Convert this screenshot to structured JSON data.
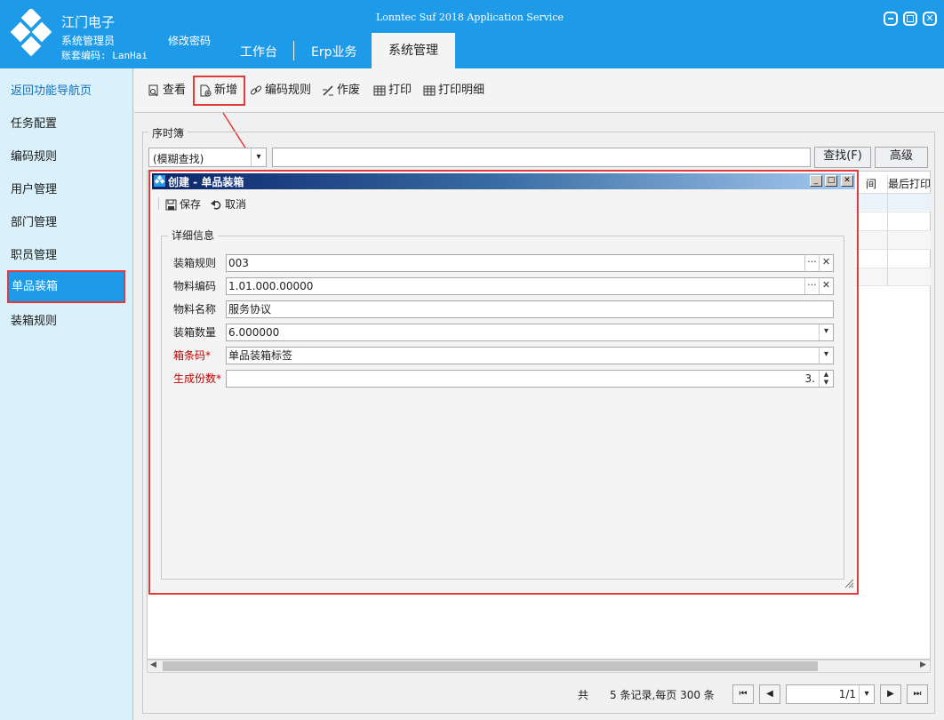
{
  "app": {
    "company": "江门电子",
    "user_role": "系统管理员",
    "account_label": "账套编码: LanHai",
    "window_title": "Lonntec Suf 2018 Application Service"
  },
  "header": {
    "change_password": "修改密码",
    "tabs": [
      {
        "label": "工作台"
      },
      {
        "label": "Erp业务"
      },
      {
        "label": "系统管理",
        "active": true
      }
    ]
  },
  "sidebar": {
    "items": [
      {
        "label": "返回功能导航页"
      },
      {
        "label": "任务配置"
      },
      {
        "label": "编码规则"
      },
      {
        "label": "用户管理"
      },
      {
        "label": "部门管理"
      },
      {
        "label": "职员管理"
      },
      {
        "label": "单品装箱",
        "active": true
      },
      {
        "label": "装箱规则"
      }
    ]
  },
  "toolbar": {
    "view": "查看",
    "new": "新增",
    "code_rule": "编码规则",
    "void": "作废",
    "print": "打印",
    "print_detail": "打印明细"
  },
  "main": {
    "group_title": "序时簿",
    "search_mode": "(模糊查找)",
    "search_value": "",
    "find_button": "查找(F)",
    "advanced_button": "高级",
    "grid_columns": [
      "间",
      "最后打印"
    ],
    "footer": {
      "total_prefix": "共",
      "summary": "5 条记录,每页 300 条",
      "page": "1/1"
    }
  },
  "dialog": {
    "title": "创建 - 单品装箱",
    "save": "保存",
    "cancel": "取消",
    "section": "详细信息",
    "fields": [
      {
        "label": "装箱规则",
        "value": "003",
        "required": false
      },
      {
        "label": "物料编码",
        "value": "1.01.000.00000",
        "required": false
      },
      {
        "label": "物料名称",
        "value": "服务协议",
        "required": false
      },
      {
        "label": "装箱数量",
        "value": "6.000000",
        "required": false
      },
      {
        "label": "箱条码*",
        "value": "单品装箱标签",
        "required": true
      },
      {
        "label": "生成份数*",
        "value": "3.",
        "required": true
      }
    ]
  },
  "colors": {
    "header_blue": "#1e9be8",
    "sidebar_bg": "#daf0fa",
    "highlight_red": "#e43a3a",
    "required_red": "#c00000"
  }
}
